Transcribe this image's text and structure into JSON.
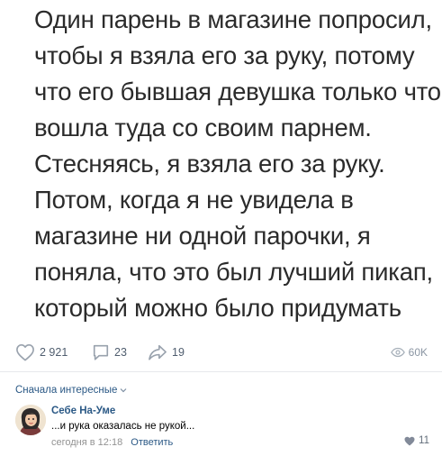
{
  "post": {
    "lines": [
      "Один парень в магазине попросил,",
      "чтобы я взяла его за руку, потому",
      "что его бывшая девушка только что",
      "вошла туда со своим парнем.",
      "Стесняясь, я взяла его за руку.",
      "Потом, когда я не увидела в",
      "магазине ни одной парочки, я",
      "поняла, что это был лучший пикап,",
      "который можно было придумать"
    ]
  },
  "actions": {
    "likes": "2 921",
    "comments": "23",
    "shares": "19",
    "views": "60K"
  },
  "comments_section": {
    "sort_label": "Сначала интересные"
  },
  "comment": {
    "author": "Себе На-Уме",
    "text": "...и рука оказалась не рукой...",
    "time": "сегодня в 12:18",
    "reply_label": "Ответить",
    "likes": "11"
  },
  "icons": {
    "like": "heart-icon",
    "comment": "comment-bubble-icon",
    "share": "share-arrow-icon",
    "views": "eye-icon",
    "sort": "chevron-down-icon",
    "comment_like": "heart-icon"
  },
  "colors": {
    "link": "#2a5885",
    "icon": "#99a2ad",
    "text": "#2b2b2b",
    "meta": "#939393"
  }
}
